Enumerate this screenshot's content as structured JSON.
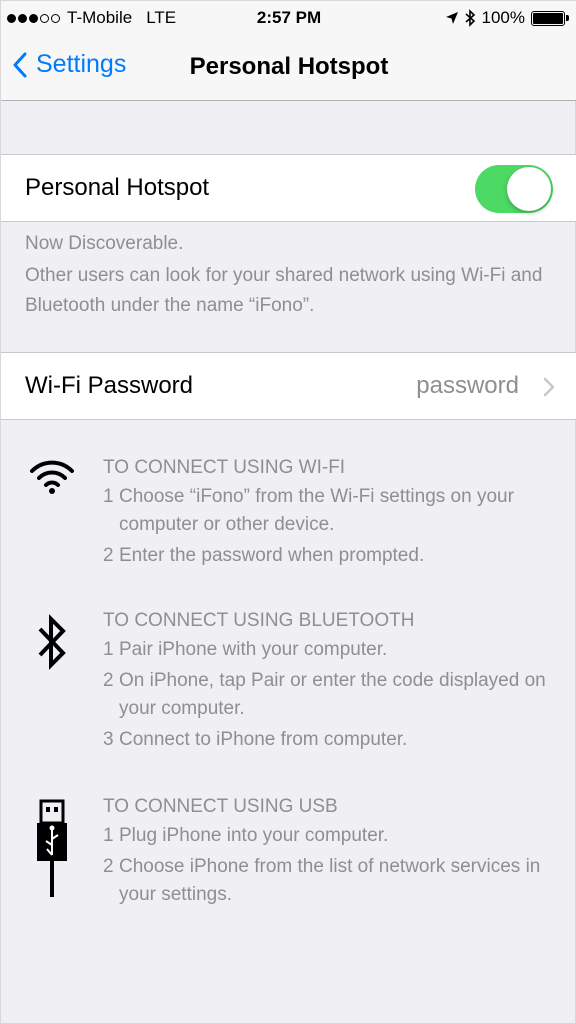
{
  "status_bar": {
    "carrier": "T-Mobile",
    "network": "LTE",
    "time": "2:57 PM",
    "battery": "100%",
    "signal_bars": 3,
    "signal_total": 5
  },
  "nav": {
    "back_label": "Settings",
    "title": "Personal Hotspot"
  },
  "hotspot": {
    "label": "Personal Hotspot",
    "enabled": true,
    "status": "Now Discoverable.",
    "description": "Other users can look for your shared network using Wi-Fi and Bluetooth under the name “iFono”."
  },
  "wifi_password": {
    "label": "Wi-Fi Password",
    "value": "password"
  },
  "instructions": {
    "wifi": {
      "icon": "wifi-icon",
      "heading": "TO CONNECT USING WI-FI",
      "steps": [
        {
          "n": "1",
          "text": "Choose “iFono” from the Wi-Fi settings on your computer or other device."
        },
        {
          "n": "2",
          "text": "Enter the password when prompted."
        }
      ]
    },
    "bluetooth": {
      "icon": "bluetooth-icon",
      "heading": "TO CONNECT USING BLUETOOTH",
      "steps": [
        {
          "n": "1",
          "text": "Pair iPhone with your computer."
        },
        {
          "n": "2",
          "text": "On iPhone, tap Pair or enter the code displayed on your computer."
        },
        {
          "n": "3",
          "text": "Connect to iPhone from computer."
        }
      ]
    },
    "usb": {
      "icon": "usb-icon",
      "heading": "TO CONNECT USING USB",
      "steps": [
        {
          "n": "1",
          "text": "Plug iPhone into your computer."
        },
        {
          "n": "2",
          "text": "Choose iPhone from the list of network services in your settings."
        }
      ]
    }
  },
  "colors": {
    "accent": "#007aff",
    "toggle_on": "#4cd964",
    "background": "#efeff4",
    "secondary_text": "#8e8e93"
  }
}
